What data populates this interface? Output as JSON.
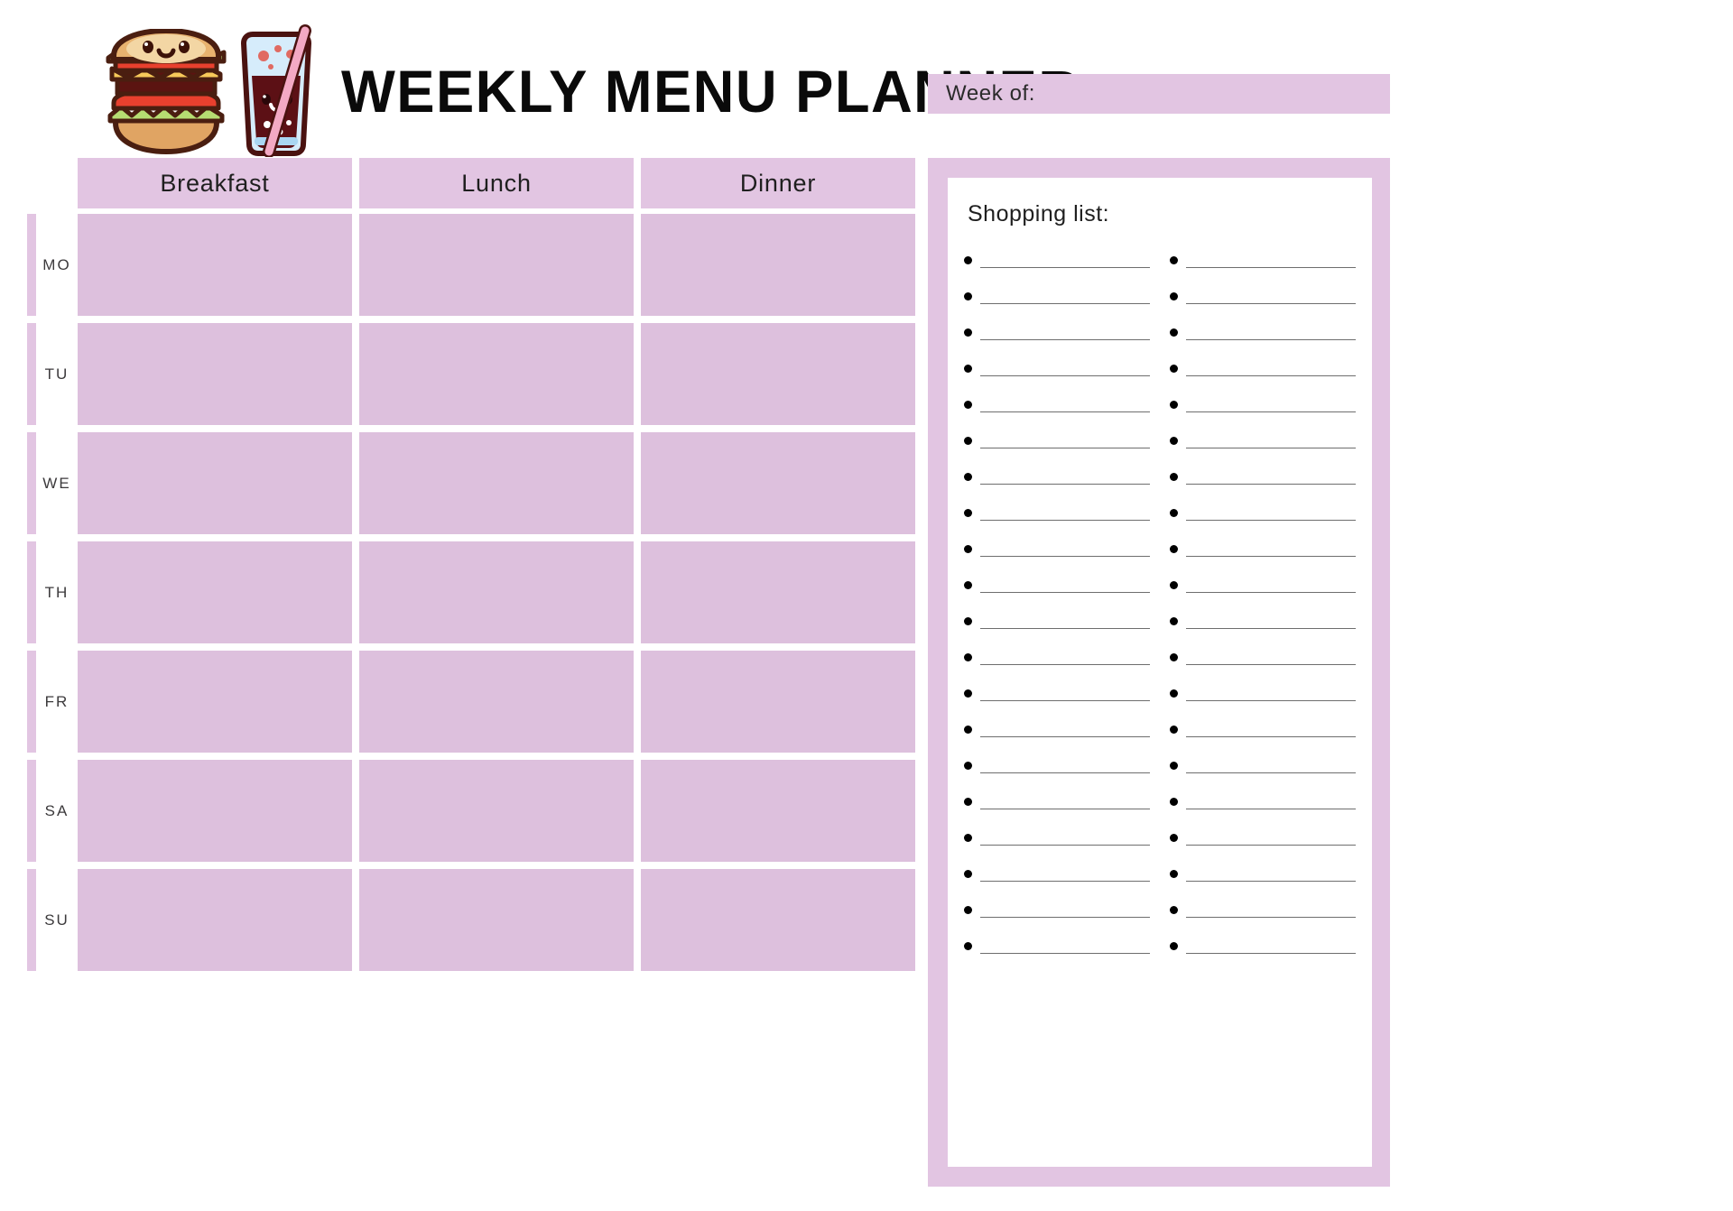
{
  "header": {
    "title": "WEEKLY MENU PLANNER",
    "week_of_label": "Week of:",
    "icons": {
      "burger": "burger-icon",
      "soda": "soda-cup-icon"
    }
  },
  "colors": {
    "lavender": "#e2c5e2",
    "lavender_cell": "#ddc0dd",
    "text_dark": "#1f1f1f",
    "day_label": "#3c3a3c",
    "line": "#6e6e6e",
    "background": "#ffffff"
  },
  "planner": {
    "columns": [
      "Breakfast",
      "Lunch",
      "Dinner"
    ],
    "days": [
      {
        "code": "MO",
        "meals": [
          "",
          "",
          ""
        ]
      },
      {
        "code": "TU",
        "meals": [
          "",
          "",
          ""
        ]
      },
      {
        "code": "WE",
        "meals": [
          "",
          "",
          ""
        ]
      },
      {
        "code": "TH",
        "meals": [
          "",
          "",
          ""
        ]
      },
      {
        "code": "FR",
        "meals": [
          "",
          "",
          ""
        ]
      },
      {
        "code": "SA",
        "meals": [
          "",
          "",
          ""
        ]
      },
      {
        "code": "SU",
        "meals": [
          "",
          "",
          ""
        ]
      }
    ]
  },
  "shopping": {
    "title": "Shopping list:",
    "rows_per_column": 20,
    "columns": 2,
    "left_column": [
      "",
      "",
      "",
      "",
      "",
      "",
      "",
      "",
      "",
      "",
      "",
      "",
      "",
      "",
      "",
      "",
      "",
      "",
      "",
      ""
    ],
    "right_column": [
      "",
      "",
      "",
      "",
      "",
      "",
      "",
      "",
      "",
      "",
      "",
      "",
      "",
      "",
      "",
      "",
      "",
      "",
      "",
      ""
    ]
  }
}
